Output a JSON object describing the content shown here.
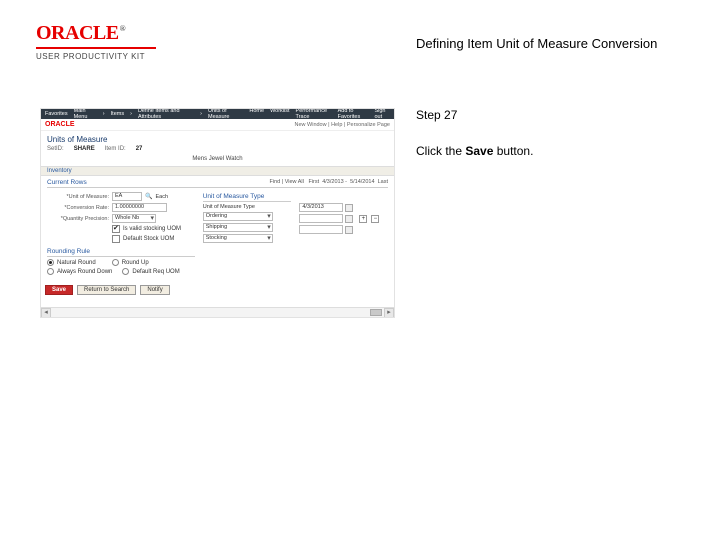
{
  "header": {
    "logo_text": "ORACLE",
    "logo_tm": "®",
    "subtitle": "USER PRODUCTIVITY KIT"
  },
  "page_title": "Defining Item Unit of Measure Conversion",
  "instruction": {
    "step_label": "Step 27",
    "line_prefix": "Click the ",
    "line_bold": "Save",
    "line_suffix": " button."
  },
  "app": {
    "nav": {
      "items": [
        "Favorites",
        "Main Menu",
        "Items",
        "Define Items and Attributes",
        "Units of Measure"
      ],
      "right": [
        "Home",
        "Worklist",
        "Performance Trace",
        "Add to Favorites",
        "Sign out"
      ]
    },
    "logo": "ORACLE",
    "crumb": "New Window | Help | Personalize Page",
    "heading": "Units of Measure",
    "sub": {
      "setid_label": "SetID:",
      "setid_value": "SHARE",
      "itemid_label": "Item ID:",
      "itemid_value": "27"
    },
    "center_hdr": "Mens Jewel Watch",
    "tab_label": "Inventory",
    "section": {
      "group_label": "Current Rows",
      "uom_label": "*Unit of Measure:",
      "uom_value": "EA",
      "uom_hint": "Each",
      "conv_label": "*Conversion Rate:",
      "conv_value": "1.00000000",
      "qty_label": "*Quantity Precision:",
      "qty_value": "Whole Nb",
      "chk1_label": "Is valid stocking UOM",
      "chk2_label": "Default Stock UOM",
      "group2_label": "Rounding Rule",
      "r1": "Natural Round",
      "r2": "Round Up",
      "r3": "Always Round Down",
      "r4": "Default Req UOM",
      "uom_type_hdr": "Unit of Measure Type",
      "uom_type_label": "Unit of Measure Type",
      "ordering": "Ordering",
      "shipping": "Shipping",
      "stocking": "Stocking",
      "find_label": "Find | View All",
      "date_label": "First",
      "date1": "4/3/2013",
      "date2": "5/14/2014",
      "last": "Last"
    },
    "buttons": {
      "save": "Save",
      "return": "Return to Search",
      "notify": "Notify"
    }
  }
}
